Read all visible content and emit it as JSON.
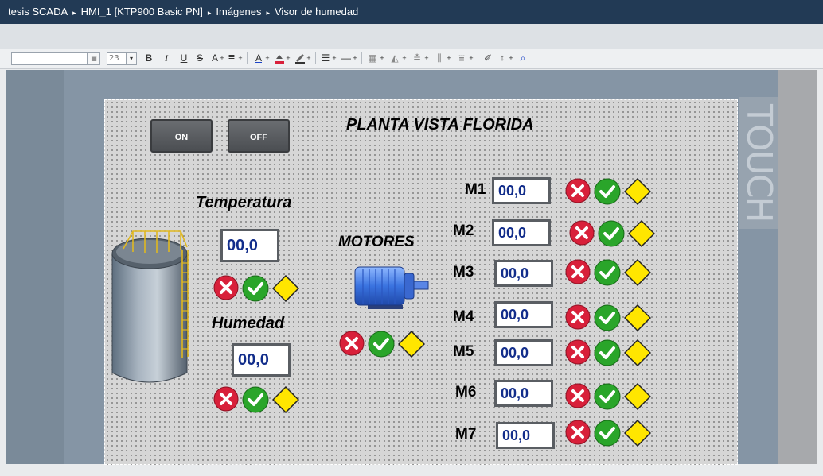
{
  "breadcrumb": {
    "items": [
      "tesis SCADA",
      "HMI_1 [KTP900 Basic PN]",
      "Imágenes",
      "Visor de humedad"
    ],
    "separator": "▸"
  },
  "toolbar": {
    "font_size": "23",
    "bold": "B",
    "italic": "I",
    "underline": "U",
    "strike": "S",
    "text_grow": "A",
    "font_color": "A",
    "plus": "±"
  },
  "panel": {
    "brand_text": "TOUCH"
  },
  "screen": {
    "on_label": "ON",
    "off_label": "OFF",
    "plant_title": "PLANTA VISTA FLORIDA",
    "temperatura_label": "Temperatura",
    "temperatura_value": "00,0",
    "humedad_label": "Humedad",
    "humedad_value": "00,0",
    "motores_label": "MOTORES",
    "motors": [
      {
        "label": "M1",
        "value": "00,0"
      },
      {
        "label": "M2",
        "value": "00,0"
      },
      {
        "label": "M3",
        "value": "00,0"
      },
      {
        "label": "M4",
        "value": "00,0"
      },
      {
        "label": "M5",
        "value": "00,0"
      },
      {
        "label": "M6",
        "value": "00,0"
      },
      {
        "label": "M7",
        "value": "00,0"
      }
    ]
  },
  "colors": {
    "titlebar": "#223a55",
    "stop_red": "#d8203a",
    "ok_green": "#2aa52a",
    "warn_yellow": "#ffe600",
    "field_text": "#122d8b",
    "field_border": "#5a5e63"
  }
}
